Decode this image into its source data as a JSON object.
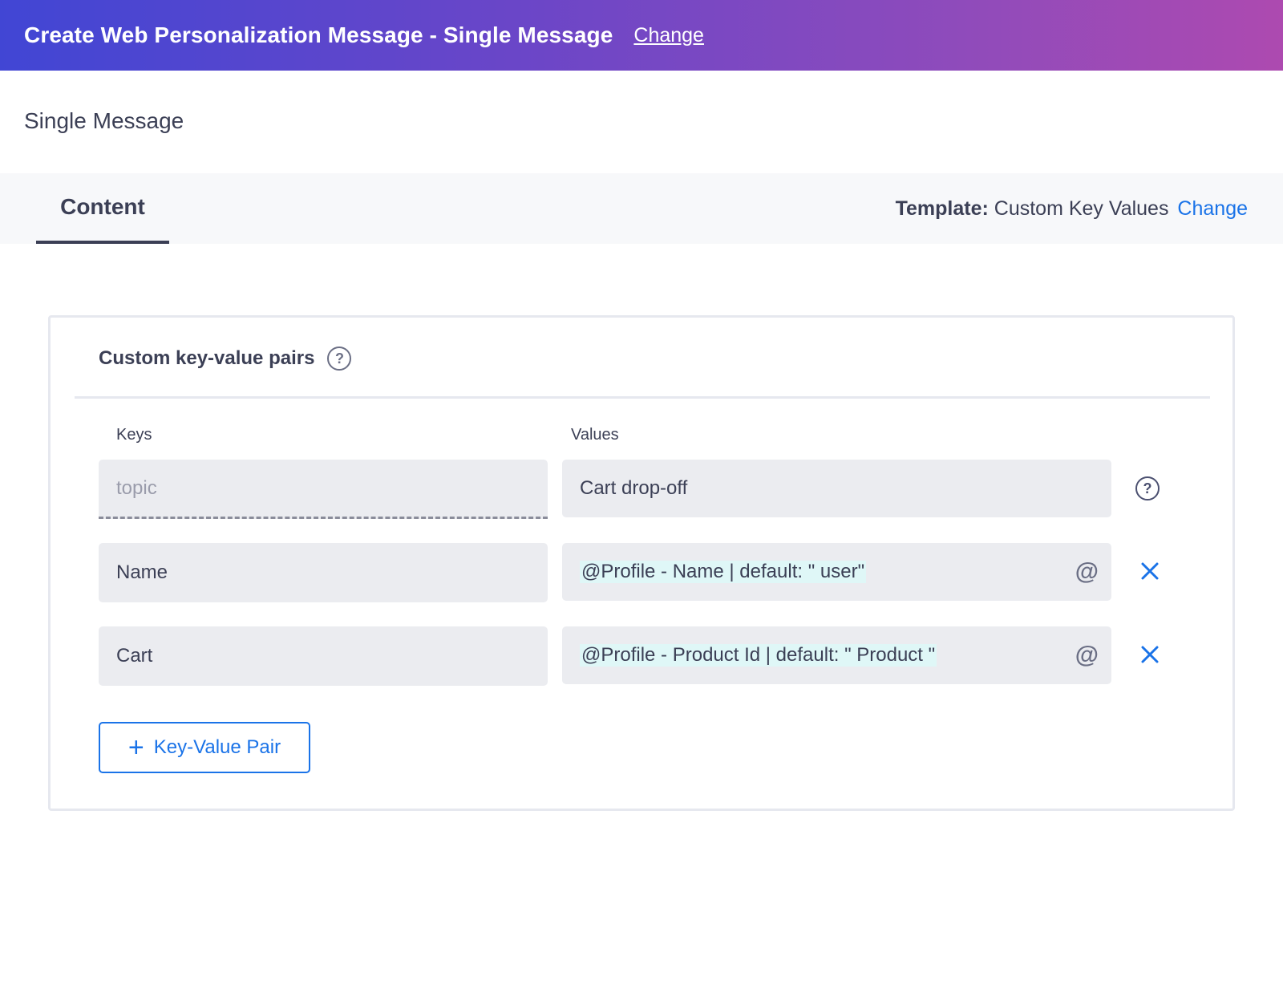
{
  "header": {
    "title": "Create Web Personalization Message - Single Message",
    "change_label": "Change"
  },
  "subheader": {
    "title": "Single Message"
  },
  "tabs": [
    {
      "label": "Content",
      "active": true
    }
  ],
  "template": {
    "label": "Template:",
    "value": "Custom Key Values",
    "change_label": "Change"
  },
  "card": {
    "title": "Custom key-value pairs",
    "keys_label": "Keys",
    "values_label": "Values",
    "rows": [
      {
        "key": "",
        "key_placeholder": "topic",
        "value": "Cart drop-off",
        "action_icon": "help-icon"
      },
      {
        "key": "Name",
        "value": "@Profile - Name | default: \" user\"",
        "action_icon": "close-icon"
      },
      {
        "key": "Cart",
        "value": "@Profile - Product Id | default: \" Product \"",
        "action_icon": "close-icon"
      }
    ],
    "add_button_label": "Key-Value Pair"
  },
  "colors": {
    "header_gradient_start": "#4146d4",
    "header_gradient_end": "#ad4ab0",
    "accent": "#1a73e8",
    "field_bg": "#ebecf0",
    "token_bg": "#dff7f7"
  }
}
